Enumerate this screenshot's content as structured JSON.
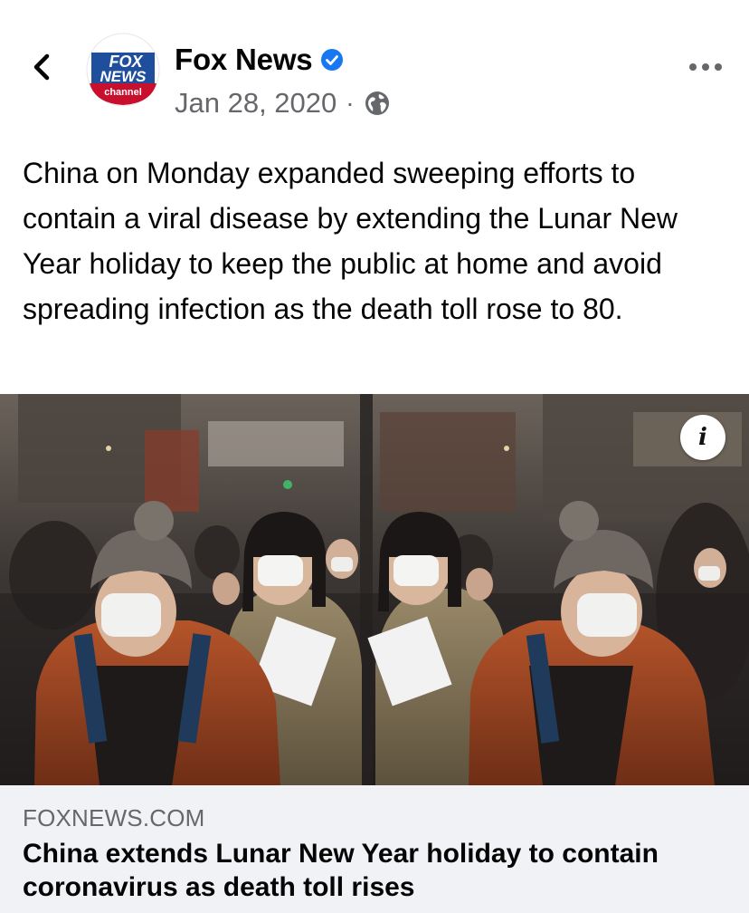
{
  "post": {
    "page_name": "Fox News",
    "verified": true,
    "date": "Jan 28, 2020",
    "separator": "·",
    "audience_icon": "globe-icon",
    "text": "China on Monday expanded sweeping efforts to contain a viral disease by extending the Lunar New Year holiday to keep the public at home and avoid spreading infection as the death toll rose to 80.",
    "avatar": {
      "logo_line1": "FOX",
      "logo_line2": "NEWS",
      "logo_line3": "channel"
    }
  },
  "nav": {
    "back_icon": "chevron-left-icon",
    "more_icon": "more-horizontal-icon"
  },
  "media": {
    "info_glyph": "i",
    "info_icon": "info-icon"
  },
  "link": {
    "domain": "FOXNEWS.COM",
    "title": "China extends Lunar New Year holiday to contain coronavirus as death toll rises"
  },
  "colors": {
    "verified_blue": "#1877f2",
    "secondary_text": "#65676b",
    "link_card_bg": "#f0f2f5",
    "fox_red": "#c8102e",
    "fox_blue": "#1f4e9c"
  }
}
